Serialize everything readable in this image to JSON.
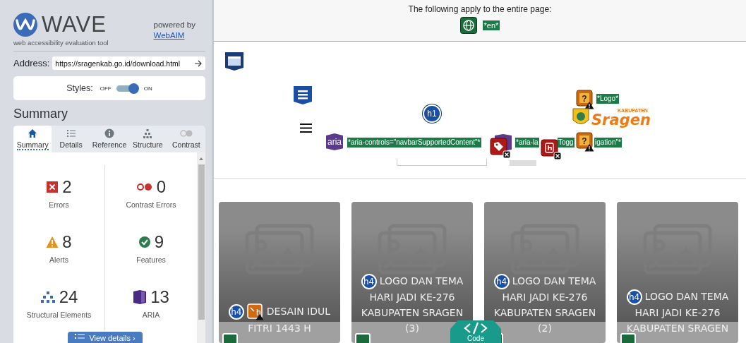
{
  "sidebar": {
    "logo_text": "WAVE",
    "tagline": "web accessibility evaluation tool",
    "powered_by": "powered by",
    "powered_link": "WebAIM",
    "address": {
      "label": "Address:",
      "value": "https://sragenkab.go.id/download.html"
    },
    "styles": {
      "label": "Styles:",
      "off_label": "OFF",
      "on_label": "ON",
      "on": true
    },
    "heading": "Summary",
    "tabs": [
      {
        "label": "Summary",
        "selected": true
      },
      {
        "label": "Details",
        "selected": false
      },
      {
        "label": "Reference",
        "selected": false
      },
      {
        "label": "Structure",
        "selected": false
      },
      {
        "label": "Contrast",
        "selected": false
      }
    ],
    "stats": [
      {
        "kind": "error",
        "count": "2",
        "label": "Errors"
      },
      {
        "kind": "contrast",
        "count": "0",
        "label": "Contrast Errors"
      },
      {
        "kind": "alert",
        "count": "8",
        "label": "Alerts"
      },
      {
        "kind": "feature",
        "count": "9",
        "label": "Features"
      },
      {
        "kind": "structure",
        "count": "24",
        "label": "Structural Elements"
      },
      {
        "kind": "aria",
        "count": "13",
        "label": "ARIA"
      }
    ],
    "view_details": "View details ›"
  },
  "page_preview": {
    "notice": "The following apply to the entire page:",
    "language_label": "*en*",
    "annotations": [
      {
        "kind": "header-region"
      },
      {
        "kind": "nav-region"
      },
      {
        "kind": "heading",
        "text": "h1"
      },
      {
        "kind": "hamburger"
      },
      {
        "kind": "aria",
        "text": "aria"
      },
      {
        "kind": "label",
        "text": "*aria-controls=\"navbarSupportedContent\"*"
      },
      {
        "kind": "aria-box"
      },
      {
        "kind": "label",
        "text": "*aria-la"
      },
      {
        "kind": "error-tag"
      },
      {
        "kind": "error-touch"
      },
      {
        "kind": "label",
        "text": "Togg"
      },
      {
        "kind": "alert-image",
        "glyph": "?"
      },
      {
        "kind": "label",
        "text": "*Logo*"
      },
      {
        "kind": "logo",
        "small": "KABUPATEN",
        "big": "Sragen"
      },
      {
        "kind": "alert-image",
        "glyph": "?"
      },
      {
        "kind": "label",
        "text": "igation\"*"
      }
    ],
    "cards": [
      {
        "heading": "h4",
        "alert": true,
        "alert_glyph": "h",
        "title": "DESAIN IDUL FITRI 1443 H"
      },
      {
        "heading": "h4",
        "alert": false,
        "title": "LOGO DAN TEMA HARI JADI KE-276 KABUPATEN SRAGEN (3)"
      },
      {
        "heading": "h4",
        "alert": false,
        "title": "LOGO DAN TEMA HARI JADI KE-276 KABUPATEN SRAGEN (2)"
      },
      {
        "heading": "h4",
        "alert": false,
        "title": "LOGO DAN TEMA HARI JADI KE-276 KABUPATEN SRAGEN"
      }
    ],
    "code_button": "Code"
  }
}
